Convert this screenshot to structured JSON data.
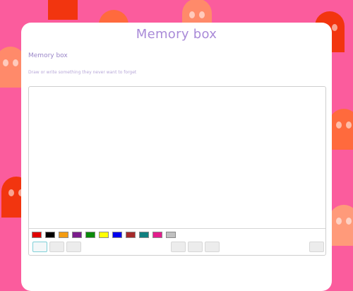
{
  "page": {
    "title": "Memory box"
  },
  "section": {
    "title": "Memory box",
    "hint": "Draw or write something they never want to forget"
  },
  "palette": [
    {
      "name": "red",
      "color": "#e00000"
    },
    {
      "name": "black",
      "color": "#000000"
    },
    {
      "name": "orange",
      "color": "#f39c12"
    },
    {
      "name": "purple",
      "color": "#7b1c8c"
    },
    {
      "name": "green",
      "color": "#0a8a0a"
    },
    {
      "name": "yellow",
      "color": "#ffff00"
    },
    {
      "name": "blue",
      "color": "#0000ee"
    },
    {
      "name": "brown",
      "color": "#a52a2a"
    },
    {
      "name": "teal",
      "color": "#108080"
    },
    {
      "name": "magenta",
      "color": "#e31c8c"
    },
    {
      "name": "silver",
      "color": "#c0c0c0"
    }
  ],
  "colors": {
    "background": "#fb5c9d",
    "title": "#a98ad8",
    "ghost_orange": "#ff6a3d",
    "ghost_red": "#f2350f",
    "ghost_peach": "#ff9a7a"
  }
}
